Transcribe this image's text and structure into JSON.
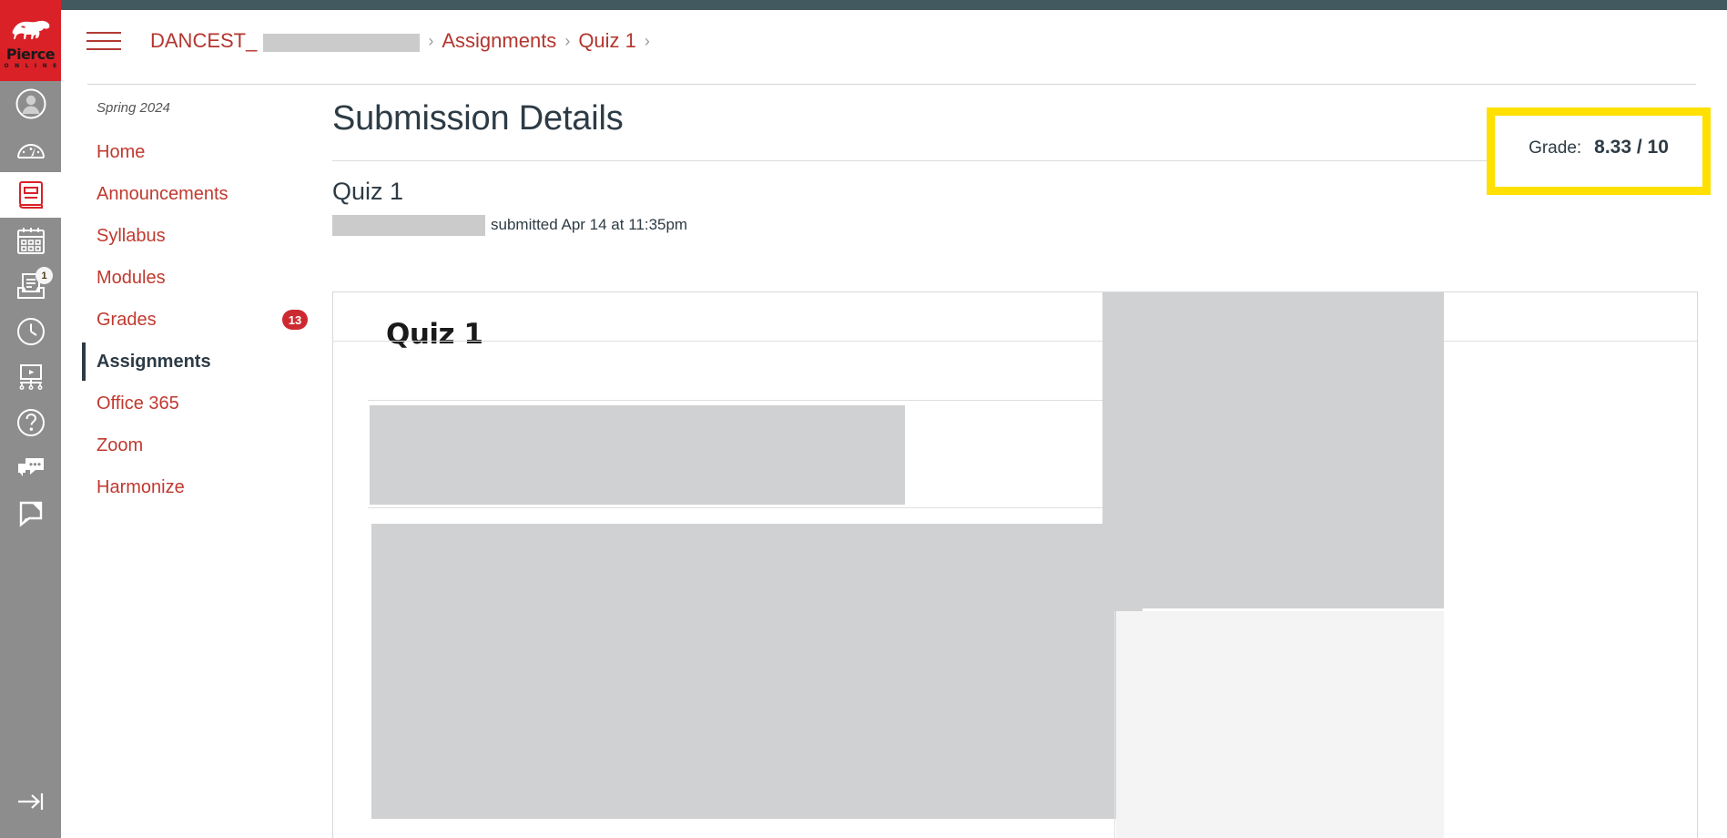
{
  "brand": {
    "name": "Pierce",
    "sub_name": "O N L I N E",
    "logo_icon": "bison-logo-icon",
    "bg_color": "#da2128"
  },
  "global_nav": {
    "items": [
      {
        "name": "account",
        "icon": "account-avatar-icon",
        "label": "Account",
        "active": false,
        "badge": null
      },
      {
        "name": "dashboard",
        "icon": "dashboard-gauge-icon",
        "label": "Dashboard",
        "active": false,
        "badge": null
      },
      {
        "name": "courses",
        "icon": "courses-book-icon",
        "label": "Courses",
        "active": true,
        "badge": null
      },
      {
        "name": "calendar",
        "icon": "calendar-icon",
        "label": "Calendar",
        "active": false,
        "badge": null
      },
      {
        "name": "inbox",
        "icon": "inbox-tray-icon",
        "label": "Inbox",
        "active": false,
        "badge": "1"
      },
      {
        "name": "history",
        "icon": "history-clock-icon",
        "label": "History",
        "active": false,
        "badge": null
      },
      {
        "name": "studio",
        "icon": "studio-screen-icon",
        "label": "Studio",
        "active": false,
        "badge": null
      },
      {
        "name": "help",
        "icon": "help-question-icon",
        "label": "Help",
        "active": false,
        "badge": null
      },
      {
        "name": "chat",
        "icon": "chat-bubbles-icon",
        "label": "Chat",
        "active": false,
        "badge": null
      },
      {
        "name": "comments",
        "icon": "comment-flag-icon",
        "label": "Comments",
        "active": false,
        "badge": null
      }
    ],
    "collapse": {
      "icon": "arrow-to-line-right-icon",
      "label": "Expand navigation"
    }
  },
  "header": {
    "menu_icon": "hamburger-menu-icon",
    "breadcrumb": [
      {
        "label": "DANCEST_",
        "redacted": true
      },
      {
        "label": "Assignments",
        "redacted": false
      },
      {
        "label": "Quiz 1",
        "redacted": false
      }
    ],
    "separator": "›"
  },
  "course_nav": {
    "term": "Spring 2024",
    "items": [
      {
        "label": "Home",
        "active": false,
        "badge": null
      },
      {
        "label": "Announcements",
        "active": false,
        "badge": null
      },
      {
        "label": "Syllabus",
        "active": false,
        "badge": null
      },
      {
        "label": "Modules",
        "active": false,
        "badge": null
      },
      {
        "label": "Grades",
        "active": false,
        "badge": "13"
      },
      {
        "label": "Assignments",
        "active": true,
        "badge": null
      },
      {
        "label": "Office 365",
        "active": false,
        "badge": null
      },
      {
        "label": "Zoom",
        "active": false,
        "badge": null
      },
      {
        "label": "Harmonize",
        "active": false,
        "badge": null
      }
    ]
  },
  "main": {
    "page_title": "Submission Details",
    "submission_title": "Quiz 1",
    "submitted_text": "submitted Apr 14 at 11:35pm",
    "student_name_redacted": true
  },
  "grade": {
    "label": "Grade:",
    "value": "8.33 / 10",
    "highlight_color": "#ffe000"
  },
  "preview": {
    "doc_title": "Quiz 1",
    "redacted_color": "#d0d1d3"
  }
}
